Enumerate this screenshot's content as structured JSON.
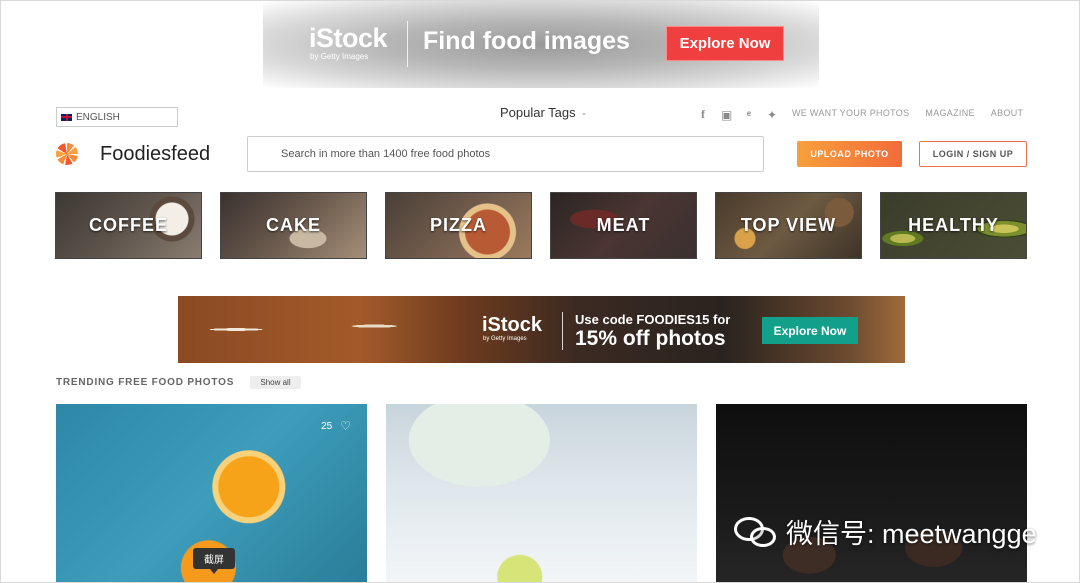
{
  "top_ad": {
    "brand": "iStock",
    "brand_sub": "by Getty Images",
    "headline": "Find food images",
    "cta": "Explore Now"
  },
  "header": {
    "language": "ENGLISH",
    "popular_tags": "Popular Tags",
    "social_icons": [
      "facebook-icon",
      "instagram-icon",
      "pinterest-icon",
      "twitter-icon"
    ],
    "links": [
      "WE WANT YOUR PHOTOS",
      "MAGAZINE",
      "ABOUT"
    ],
    "logo_text": "Foodiesfeed",
    "search_placeholder": "Search in more than 1400 free food photos",
    "upload_label": "UPLOAD PHOTO",
    "login_label": "LOGIN / SIGN UP",
    "accent_color": "#f26b3a"
  },
  "categories": [
    "COFFEE",
    "CAKE",
    "PIZZA",
    "MEAT",
    "TOP VIEW",
    "HEALTHY"
  ],
  "mid_ad": {
    "brand": "iStock",
    "brand_sub": "by Getty Images",
    "code_line": "Use code FOODIES15 for",
    "offer_line": "15% off photos",
    "cta": "Explore Now",
    "cta_color": "#12a08a"
  },
  "trending": {
    "title": "TRENDING FREE FOOD PHOTOS",
    "show_all": "Show all",
    "photos": [
      {
        "likes": "25"
      },
      {},
      {}
    ]
  },
  "tooltip": "截屏",
  "watermark": "微信号: meetwangge"
}
